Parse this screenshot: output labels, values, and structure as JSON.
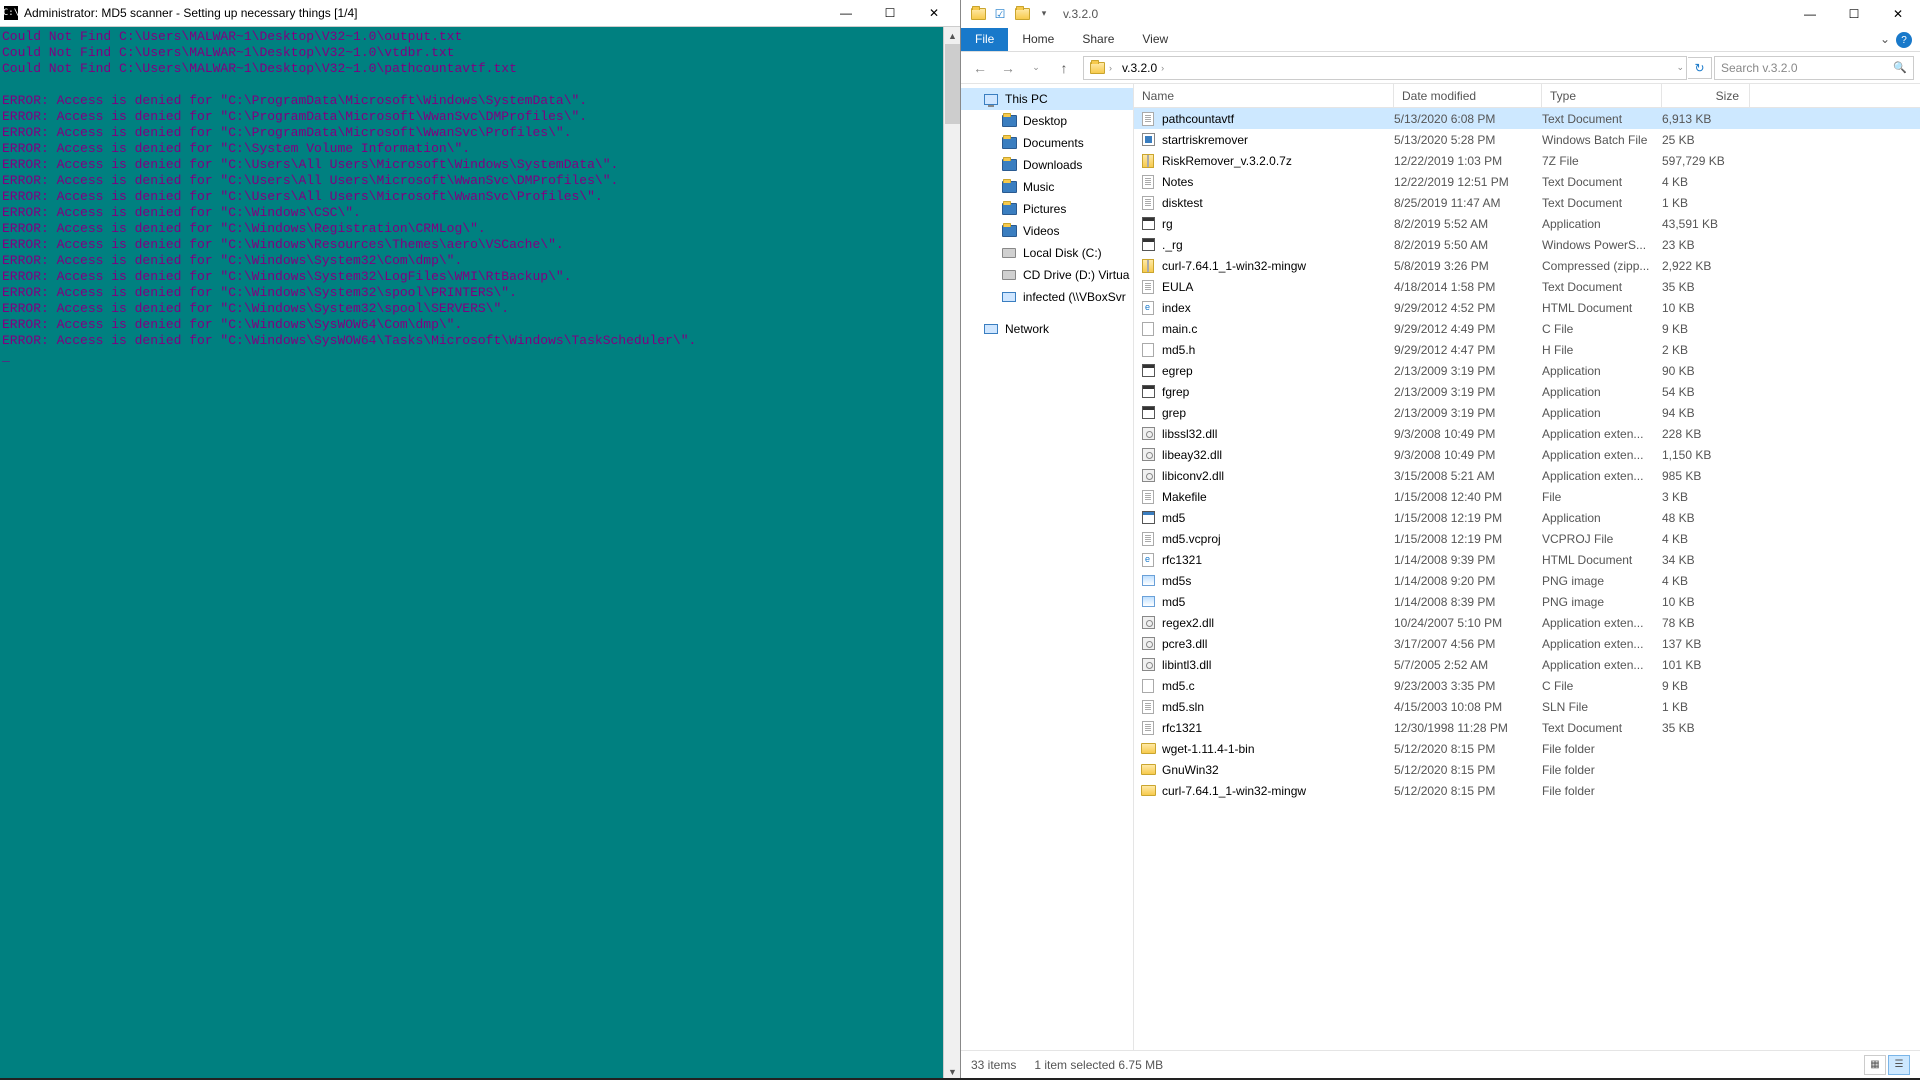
{
  "console": {
    "title": "Administrator:  MD5 scanner - Setting up necessary things [1/4]",
    "min": "—",
    "max": "☐",
    "close": "✕",
    "lines": [
      "Could Not Find C:\\Users\\MALWAR~1\\Desktop\\V32~1.0\\output.txt",
      "Could Not Find C:\\Users\\MALWAR~1\\Desktop\\V32~1.0\\vtdbr.txt",
      "Could Not Find C:\\Users\\MALWAR~1\\Desktop\\V32~1.0\\pathcountavtf.txt",
      "",
      "ERROR: Access is denied for \"C:\\ProgramData\\Microsoft\\Windows\\SystemData\\\".",
      "ERROR: Access is denied for \"C:\\ProgramData\\Microsoft\\WwanSvc\\DMProfiles\\\".",
      "ERROR: Access is denied for \"C:\\ProgramData\\Microsoft\\WwanSvc\\Profiles\\\".",
      "ERROR: Access is denied for \"C:\\System Volume Information\\\".",
      "ERROR: Access is denied for \"C:\\Users\\All Users\\Microsoft\\Windows\\SystemData\\\".",
      "ERROR: Access is denied for \"C:\\Users\\All Users\\Microsoft\\WwanSvc\\DMProfiles\\\".",
      "ERROR: Access is denied for \"C:\\Users\\All Users\\Microsoft\\WwanSvc\\Profiles\\\".",
      "ERROR: Access is denied for \"C:\\Windows\\CSC\\\".",
      "ERROR: Access is denied for \"C:\\Windows\\Registration\\CRMLog\\\".",
      "ERROR: Access is denied for \"C:\\Windows\\Resources\\Themes\\aero\\VSCache\\\".",
      "ERROR: Access is denied for \"C:\\Windows\\System32\\Com\\dmp\\\".",
      "ERROR: Access is denied for \"C:\\Windows\\System32\\LogFiles\\WMI\\RtBackup\\\".",
      "ERROR: Access is denied for \"C:\\Windows\\System32\\spool\\PRINTERS\\\".",
      "ERROR: Access is denied for \"C:\\Windows\\System32\\spool\\SERVERS\\\".",
      "ERROR: Access is denied for \"C:\\Windows\\SysWOW64\\Com\\dmp\\\".",
      "ERROR: Access is denied for \"C:\\Windows\\SysWOW64\\Tasks\\Microsoft\\Windows\\TaskScheduler\\\".",
      "_"
    ]
  },
  "explorer": {
    "title_text": "v.3.2.0",
    "qat_down": "▾",
    "min": "—",
    "max": "☐",
    "close": "✕",
    "tabs": {
      "file": "File",
      "home": "Home",
      "share": "Share",
      "view": "View"
    },
    "help_dd": "⌄",
    "help_q": "?",
    "nav_back": "←",
    "nav_fwd": "→",
    "nav_dd": "⌄",
    "nav_up": "↑",
    "crumb_label": "v.3.2.0",
    "crumb_sep": "›",
    "crumb_dd": "⌄",
    "refresh": "↻",
    "search_placeholder": "Search v.3.2.0",
    "search_icon": "🔍",
    "cols": {
      "name": "Name",
      "date": "Date modified",
      "type": "Type",
      "size": "Size"
    },
    "navpane": [
      {
        "label": "This PC",
        "kind": "pc",
        "sel": true,
        "sub": false
      },
      {
        "label": "Desktop",
        "kind": "fold",
        "sub": true,
        "color": "#3a7ec0"
      },
      {
        "label": "Documents",
        "kind": "fold",
        "sub": true,
        "color": "#3a7ec0"
      },
      {
        "label": "Downloads",
        "kind": "fold",
        "sub": true,
        "color": "#3a7ec0"
      },
      {
        "label": "Music",
        "kind": "fold",
        "sub": true,
        "color": "#3a7ec0"
      },
      {
        "label": "Pictures",
        "kind": "fold",
        "sub": true,
        "color": "#3a7ec0"
      },
      {
        "label": "Videos",
        "kind": "fold",
        "sub": true,
        "color": "#3a7ec0"
      },
      {
        "label": "Local Disk (C:)",
        "kind": "drv",
        "sub": true
      },
      {
        "label": "CD Drive (D:) Virtua",
        "kind": "drv",
        "sub": true
      },
      {
        "label": "infected (\\\\VBoxSvr",
        "kind": "net",
        "sub": true
      },
      {
        "spacer": true
      },
      {
        "label": "Network",
        "kind": "net",
        "sub": false
      }
    ],
    "files": [
      {
        "n": "pathcountavtf",
        "d": "5/13/2020 6:08 PM",
        "t": "Text Document",
        "s": "6,913 KB",
        "i": "txt",
        "sel": true
      },
      {
        "n": "startriskremover",
        "d": "5/13/2020 5:28 PM",
        "t": "Windows Batch File",
        "s": "25 KB",
        "i": "bat"
      },
      {
        "n": "RiskRemover_v.3.2.0.7z",
        "d": "12/22/2019 1:03 PM",
        "t": "7Z File",
        "s": "597,729 KB",
        "i": "zip"
      },
      {
        "n": "Notes",
        "d": "12/22/2019 12:51 PM",
        "t": "Text Document",
        "s": "4 KB",
        "i": "txt"
      },
      {
        "n": "disktest",
        "d": "8/25/2019 11:47 AM",
        "t": "Text Document",
        "s": "1 KB",
        "i": "txt"
      },
      {
        "n": "rg",
        "d": "8/2/2019 5:52 AM",
        "t": "Application",
        "s": "43,591 KB",
        "i": "exedark"
      },
      {
        "n": "._rg",
        "d": "8/2/2019 5:50 AM",
        "t": "Windows PowerS...",
        "s": "23 KB",
        "i": "exedark"
      },
      {
        "n": "curl-7.64.1_1-win32-mingw",
        "d": "5/8/2019 3:26 PM",
        "t": "Compressed (zipp...",
        "s": "2,922 KB",
        "i": "zip"
      },
      {
        "n": "EULA",
        "d": "4/18/2014 1:58 PM",
        "t": "Text Document",
        "s": "35 KB",
        "i": "txt"
      },
      {
        "n": "index",
        "d": "9/29/2012 4:52 PM",
        "t": "HTML Document",
        "s": "10 KB",
        "i": "html"
      },
      {
        "n": "main.c",
        "d": "9/29/2012 4:49 PM",
        "t": "C File",
        "s": "9 KB",
        "i": "c"
      },
      {
        "n": "md5.h",
        "d": "9/29/2012 4:47 PM",
        "t": "H File",
        "s": "2 KB",
        "i": "c"
      },
      {
        "n": "egrep",
        "d": "2/13/2009 3:19 PM",
        "t": "Application",
        "s": "90 KB",
        "i": "exedark"
      },
      {
        "n": "fgrep",
        "d": "2/13/2009 3:19 PM",
        "t": "Application",
        "s": "54 KB",
        "i": "exedark"
      },
      {
        "n": "grep",
        "d": "2/13/2009 3:19 PM",
        "t": "Application",
        "s": "94 KB",
        "i": "exedark"
      },
      {
        "n": "libssl32.dll",
        "d": "9/3/2008 10:49 PM",
        "t": "Application exten...",
        "s": "228 KB",
        "i": "dll"
      },
      {
        "n": "libeay32.dll",
        "d": "9/3/2008 10:49 PM",
        "t": "Application exten...",
        "s": "1,150 KB",
        "i": "dll"
      },
      {
        "n": "libiconv2.dll",
        "d": "3/15/2008 5:21 AM",
        "t": "Application exten...",
        "s": "985 KB",
        "i": "dll"
      },
      {
        "n": "Makefile",
        "d": "1/15/2008 12:40 PM",
        "t": "File",
        "s": "3 KB",
        "i": "txt"
      },
      {
        "n": "md5",
        "d": "1/15/2008 12:19 PM",
        "t": "Application",
        "s": "48 KB",
        "i": "exe"
      },
      {
        "n": "md5.vcproj",
        "d": "1/15/2008 12:19 PM",
        "t": "VCPROJ File",
        "s": "4 KB",
        "i": "txt"
      },
      {
        "n": "rfc1321",
        "d": "1/14/2008 9:39 PM",
        "t": "HTML Document",
        "s": "34 KB",
        "i": "html"
      },
      {
        "n": "md5s",
        "d": "1/14/2008 9:20 PM",
        "t": "PNG image",
        "s": "4 KB",
        "i": "png"
      },
      {
        "n": "md5",
        "d": "1/14/2008 8:39 PM",
        "t": "PNG image",
        "s": "10 KB",
        "i": "png"
      },
      {
        "n": "regex2.dll",
        "d": "10/24/2007 5:10 PM",
        "t": "Application exten...",
        "s": "78 KB",
        "i": "dll"
      },
      {
        "n": "pcre3.dll",
        "d": "3/17/2007 4:56 PM",
        "t": "Application exten...",
        "s": "137 KB",
        "i": "dll"
      },
      {
        "n": "libintl3.dll",
        "d": "5/7/2005 2:52 AM",
        "t": "Application exten...",
        "s": "101 KB",
        "i": "dll"
      },
      {
        "n": "md5.c",
        "d": "9/23/2003 3:35 PM",
        "t": "C File",
        "s": "9 KB",
        "i": "c"
      },
      {
        "n": "md5.sln",
        "d": "4/15/2003 10:08 PM",
        "t": "SLN File",
        "s": "1 KB",
        "i": "txt"
      },
      {
        "n": "rfc1321",
        "d": "12/30/1998 11:28 PM",
        "t": "Text Document",
        "s": "35 KB",
        "i": "txt"
      },
      {
        "n": "wget-1.11.4-1-bin",
        "d": "5/12/2020 8:15 PM",
        "t": "File folder",
        "s": "",
        "i": "fold"
      },
      {
        "n": "GnuWin32",
        "d": "5/12/2020 8:15 PM",
        "t": "File folder",
        "s": "",
        "i": "fold"
      },
      {
        "n": "curl-7.64.1_1-win32-mingw",
        "d": "5/12/2020 8:15 PM",
        "t": "File folder",
        "s": "",
        "i": "fold"
      }
    ],
    "status": {
      "count": "33 items",
      "sel": "1 item selected  6.75 MB"
    }
  }
}
